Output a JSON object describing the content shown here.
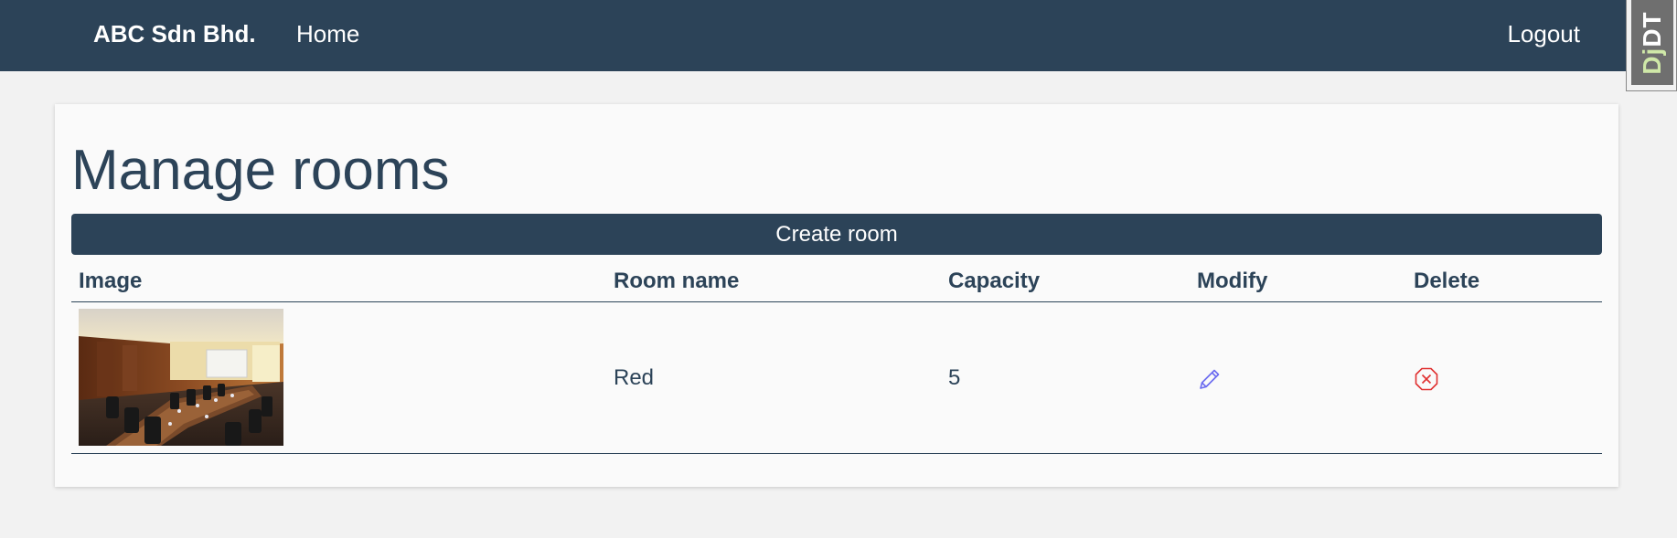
{
  "navbar": {
    "brand": "ABC Sdn Bhd.",
    "home_label": "Home",
    "logout_label": "Logout",
    "bg_color": "#2c4358"
  },
  "debug_toolbar": {
    "label_dj": "Dj",
    "label_dt": "DT"
  },
  "main": {
    "title": "Manage rooms",
    "create_button_label": "Create room"
  },
  "table": {
    "headers": {
      "image": "Image",
      "room_name": "Room name",
      "capacity": "Capacity",
      "modify": "Modify",
      "delete": "Delete"
    },
    "rows": [
      {
        "image_icon": "conference-room-photo",
        "room_name": "Red",
        "capacity": "5",
        "modify_icon": "pencil-icon",
        "delete_icon": "close-circle-icon"
      }
    ]
  },
  "colors": {
    "primary": "#2c4358",
    "modify_icon": "#6b6bf0",
    "delete_icon": "#e03030"
  }
}
